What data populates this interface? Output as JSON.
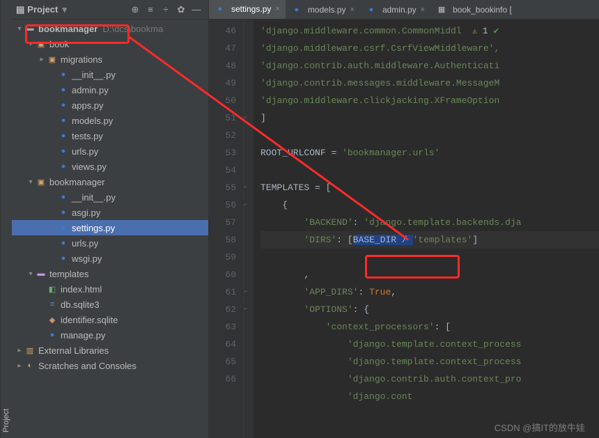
{
  "side_label": "Project",
  "panel": {
    "title": "Project",
    "root": "bookmanager",
    "root_path": "D:\\dcs\\bookma"
  },
  "tree": {
    "book": "book",
    "migrations": "migrations",
    "init_py": "__init__.py",
    "admin_py": "admin.py",
    "apps_py": "apps.py",
    "models_py": "models.py",
    "tests_py": "tests.py",
    "urls_py": "urls.py",
    "views_py": "views.py",
    "bookmanager": "bookmanager",
    "asgi_py": "asgi.py",
    "settings_py": "settings.py",
    "urls_py2": "urls.py",
    "wsgi_py": "wsgi.py",
    "templates": "templates",
    "index_html": "index.html",
    "db_sqlite3": "db.sqlite3",
    "identifier_sqlite": "identifier.sqlite",
    "manage_py": "manage.py",
    "external_libraries": "External Libraries",
    "scratches": "Scratches and Consoles"
  },
  "tabs": {
    "settings": "settings.py",
    "models": "models.py",
    "admin": "admin.py",
    "book_bookinfo": "book_bookinfo ["
  },
  "code": {
    "warn_count": "1",
    "l46": "'django.middleware.common.CommonMiddl",
    "l47": "'django.middleware.csrf.CsrfViewMiddleware',",
    "l48": "'django.contrib.auth.middleware.Authenticati",
    "l49": "'django.contrib.messages.middleware.MessageM",
    "l50": "'django.middleware.clickjacking.XFrameOption",
    "l53_id": "ROOT_URLCONF",
    "l53_val": "'bookmanager.urls'",
    "l55_id": "TEMPLATES",
    "l57_k": "'BACKEND'",
    "l57_v": "'django.template.backends.dja",
    "l58_k": "'DIRS'",
    "l58_v1": "BASE_DIR / ",
    "l58_v2": "'templates'",
    "l60_k": "'APP_DIRS'",
    "l60_v": "True",
    "l61_k": "'OPTIONS'",
    "l62_k": "'context_processors'",
    "l63": "'django.template.context_process",
    "l64": "'django.template.context_process",
    "l65": "'django.contrib.auth.context_pro",
    "l66": "'django.cont"
  },
  "line_numbers": [
    "46",
    "47",
    "48",
    "49",
    "50",
    "51",
    "52",
    "53",
    "54",
    "55",
    "56",
    "57",
    "58",
    "59",
    "60",
    "61",
    "62",
    "63",
    "64",
    "65",
    "66"
  ],
  "watermark": "CSDN @搞IT的放牛娃"
}
